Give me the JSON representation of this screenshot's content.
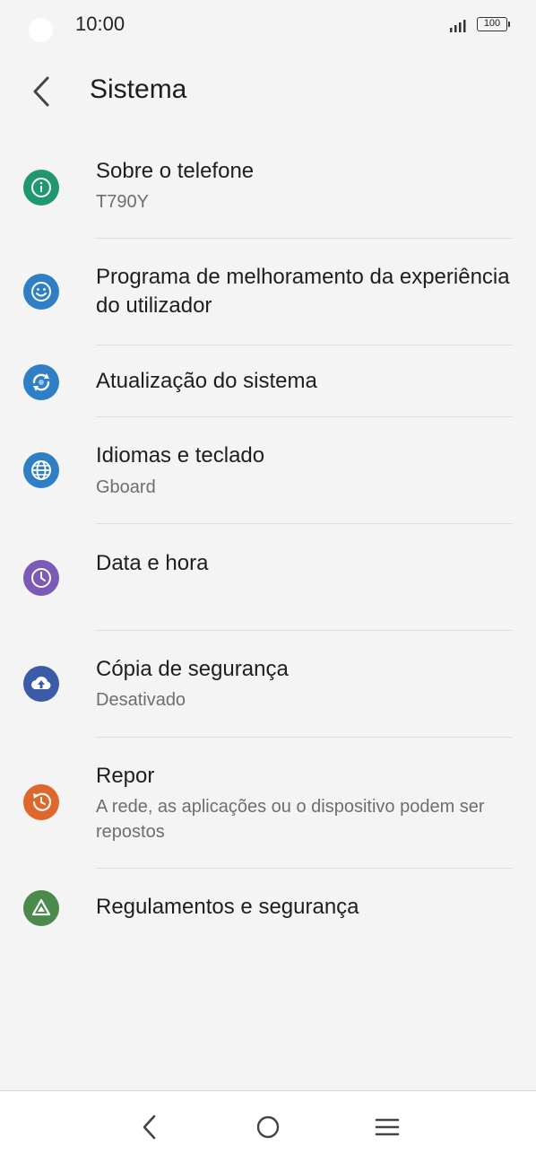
{
  "status_bar": {
    "time": "10:00",
    "battery": "100",
    "signal_icon": "signal-icon"
  },
  "header": {
    "title": "Sistema",
    "back_icon": "back-arrow-icon"
  },
  "items": [
    {
      "title": "Sobre o telefone",
      "subtitle": "T790Y",
      "icon": "info-icon",
      "color": "#1f9872"
    },
    {
      "title": "Programa de melhoramento da experiência do utilizador",
      "subtitle": "",
      "icon": "smiley-icon",
      "color": "#2f7fc7"
    },
    {
      "title": "Atualização do sistema",
      "subtitle": "",
      "icon": "update-icon",
      "color": "#2f7fc7"
    },
    {
      "title": "Idiomas e teclado",
      "subtitle": "Gboard",
      "icon": "globe-icon",
      "color": "#2f7fc7"
    },
    {
      "title": "Data e hora",
      "subtitle": "",
      "icon": "clock-icon",
      "color": "#7b5bb6"
    },
    {
      "title": "Cópia de segurança",
      "subtitle": "Desativado",
      "icon": "cloud-upload-icon",
      "color": "#3b5aa8"
    },
    {
      "title": "Repor",
      "subtitle": "A rede, as aplicações ou o dispositivo podem ser repostos",
      "icon": "restore-icon",
      "color": "#e0672b"
    },
    {
      "title": "Regulamentos e segurança",
      "subtitle": "",
      "icon": "regulatory-icon",
      "color": "#4a8a4a"
    }
  ],
  "nav_bar": {
    "back_icon": "nav-back-icon",
    "home_icon": "nav-home-icon",
    "menu_icon": "nav-menu-icon"
  }
}
